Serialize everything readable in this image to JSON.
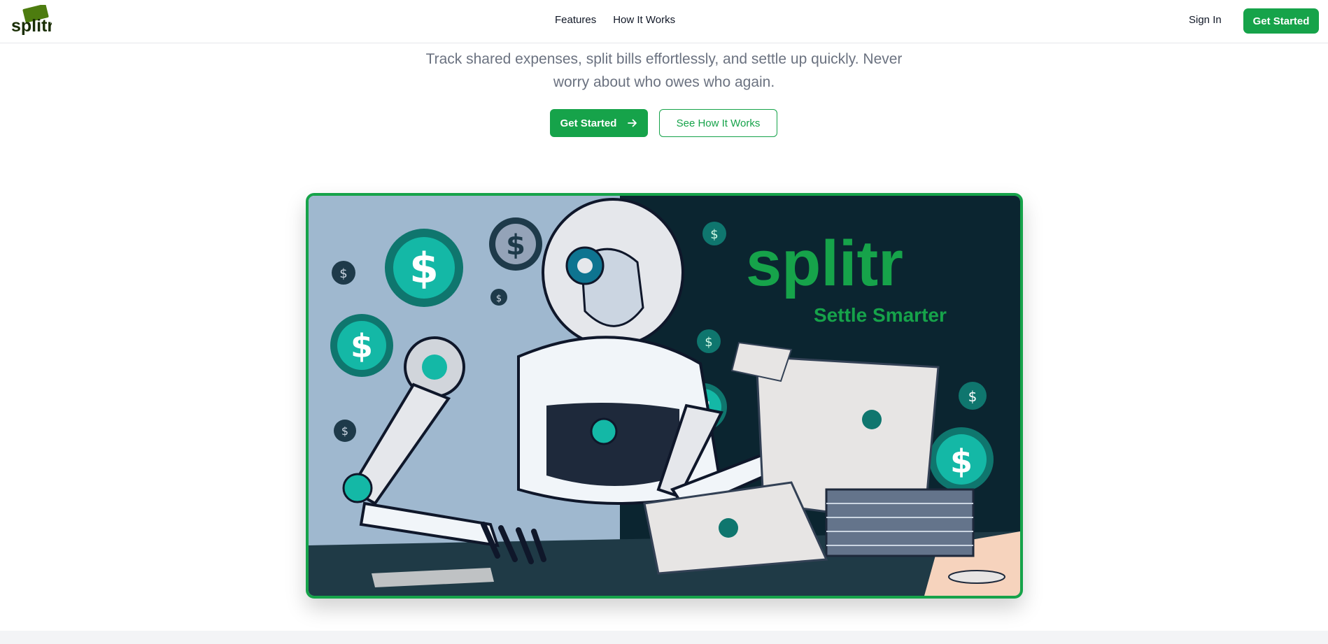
{
  "brand": {
    "logo_text": "splitr"
  },
  "nav": {
    "features": "Features",
    "how_it_works": "How It Works"
  },
  "header": {
    "sign_in": "Sign In",
    "get_started": "Get Started"
  },
  "hero": {
    "subtitle": "Track shared expenses, split bills effortlessly, and settle up quickly. Never worry about who owes who again.",
    "primary_button": "Get Started",
    "secondary_button": "See How It Works",
    "image_logo": "splitr",
    "image_tagline": "Settle Smarter"
  },
  "icons": {
    "arrow": "arrow-right-icon",
    "coin": "dollar-coin-icon"
  },
  "colors": {
    "accent": "#16a34a",
    "teal": "#14b8a6",
    "dark_panel": "#0b2530",
    "light_panel": "#9fb8cf"
  }
}
